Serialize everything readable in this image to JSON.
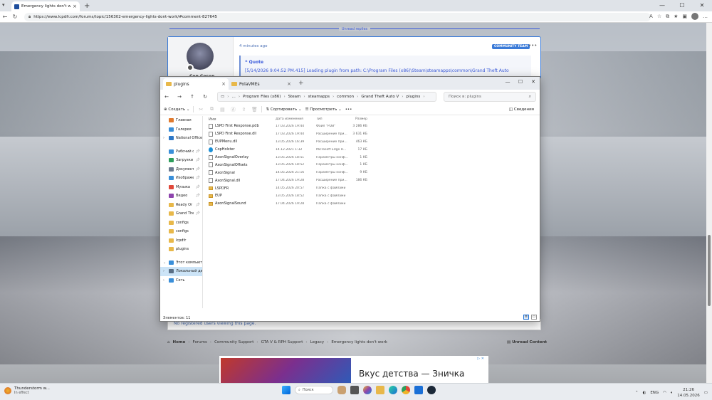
{
  "browser": {
    "tab_title": "Emergency lights don't work - Lc...",
    "url": "https://www.lcpdfr.com/forums/topic/156302-emergency-lights-dont-work/#comment-827645"
  },
  "forum": {
    "unread_label": "Unread replies",
    "post_time": "4 minutes ago",
    "badge": "COMMUNITY TEAM",
    "author": "Cop Cosen",
    "quote_label": "Quote",
    "quote_text": "[5/14/2026 9:04:52 PM.415] Loading plugin from path: C:\\Program Files (x86)\\Steam\\steamapps\\common\\Grand Theft Auto",
    "no_registered": "No registered users viewing this page.",
    "breadcrumbs": [
      "Home",
      "Forums",
      "Community Support",
      "GTA V & RPH Support",
      "Legacy",
      "Emergency lights don't work"
    ],
    "unread_content": "Unread Content",
    "ad_title": "Вкус детства — Зничка"
  },
  "explorer": {
    "tabs": [
      "plugins",
      "PolaVMEs"
    ],
    "path": [
      "Program Files (x86)",
      "Steam",
      "steamapps",
      "common",
      "Grand Theft Auto V",
      "plugins"
    ],
    "search_placeholder": "Поиск в: plugins",
    "toolbar": {
      "create": "Создать",
      "sort": "Сортировать",
      "view": "Просмотреть",
      "details": "Сведения"
    },
    "sidebar": [
      {
        "label": "Главная",
        "icon": "home-icon",
        "color": "#e07a2e"
      },
      {
        "label": "Галерея",
        "icon": "gallery-icon",
        "color": "#3a8fd9"
      },
      {
        "label": "National Office Of",
        "icon": "cloud-icon",
        "color": "#2e78c7"
      },
      {
        "label": "Рабочий стол",
        "icon": "desktop-icon",
        "color": "#3a8fd9"
      },
      {
        "label": "Загрузки",
        "icon": "download-icon",
        "color": "#2e9e5b"
      },
      {
        "label": "Документы",
        "icon": "document-icon",
        "color": "#6b7a8f"
      },
      {
        "label": "Изображения",
        "icon": "pictures-icon",
        "color": "#3a8fd9"
      },
      {
        "label": "Музыка",
        "icon": "music-icon",
        "color": "#e0483a"
      },
      {
        "label": "Видео",
        "icon": "video-icon",
        "color": "#8e44ad"
      },
      {
        "label": "Ready Or Not",
        "icon": "folder-icon",
        "color": "#e8b84a"
      },
      {
        "label": "Grand Theft Aut",
        "icon": "folder-icon",
        "color": "#e8b84a"
      },
      {
        "label": "configs",
        "icon": "folder-icon",
        "color": "#e8b84a"
      },
      {
        "label": "configs",
        "icon": "folder-icon",
        "color": "#e8b84a"
      },
      {
        "label": "lcpdfr",
        "icon": "folder-icon",
        "color": "#e8b84a"
      },
      {
        "label": "plugins",
        "icon": "folder-icon",
        "color": "#e8b84a"
      },
      {
        "label": "Этот компьютер",
        "icon": "computer-icon",
        "color": "#3a8fd9"
      },
      {
        "label": "Локальный диск",
        "icon": "drive-icon",
        "color": "#5a6f85"
      },
      {
        "label": "Сеть",
        "icon": "network-icon",
        "color": "#3a8fd9"
      }
    ],
    "columns": [
      "Имя",
      "Дата изменения",
      "Тип",
      "Размер"
    ],
    "files": [
      {
        "name": "LSPD First Response.pdb",
        "date": "17.03.2026 19:44",
        "type": "Файл \"PDB\"",
        "size": "3 286 КБ",
        "kind": "file"
      },
      {
        "name": "LSPD First Response.dll",
        "date": "17.03.2026 19:44",
        "type": "Расширение при...",
        "size": "3 631 КБ",
        "kind": "file"
      },
      {
        "name": "EUPMenu.dll",
        "date": "13.05.2026 16:39",
        "type": "Расширение при...",
        "size": "463 КБ",
        "kind": "file"
      },
      {
        "name": "CopHolster",
        "date": "14.12.2021 1:32",
        "type": "Microsoft Edge H...",
        "size": "17 КБ",
        "kind": "edge"
      },
      {
        "name": "AxonSignalOverlay",
        "date": "13.05.2026 18:51",
        "type": "Параметры конф...",
        "size": "1 КБ",
        "kind": "file"
      },
      {
        "name": "AxonSignalOffsets",
        "date": "13.05.2026 18:52",
        "type": "Параметры конф...",
        "size": "1 КБ",
        "kind": "file"
      },
      {
        "name": "AxonSignal",
        "date": "14.05.2026 21:16",
        "type": "Параметры конф...",
        "size": "9 КБ",
        "kind": "file"
      },
      {
        "name": "AxonSignal.dll",
        "date": "17.04.2026 19:28",
        "type": "Расширение при...",
        "size": "186 КБ",
        "kind": "file"
      },
      {
        "name": "LSPDFR",
        "date": "14.05.2026 20:57",
        "type": "Папка с файлами",
        "size": "",
        "kind": "folder"
      },
      {
        "name": "EUP",
        "date": "13.05.2026 18:52",
        "type": "Папка с файлами",
        "size": "",
        "kind": "folder"
      },
      {
        "name": "AxonSignalSound",
        "date": "17.04.2026 19:28",
        "type": "Папка с файлами",
        "size": "",
        "kind": "folder"
      }
    ],
    "status": "Элементов: 11"
  },
  "taskbar": {
    "weather_title": "Thunderstorm w...",
    "weather_sub": "In effect",
    "search": "Поиск",
    "lang": "ENG",
    "time": "21:26",
    "date": "14.05.2026"
  }
}
